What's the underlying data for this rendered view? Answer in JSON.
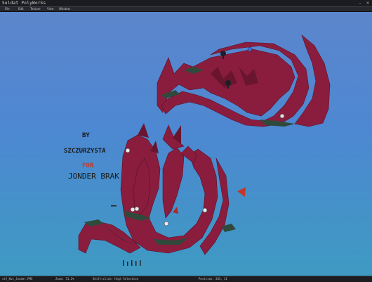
{
  "window": {
    "title": "Soldat PolyWorks",
    "minimize": "–",
    "close": "×"
  },
  "menu": {
    "items": [
      "File",
      "Edit",
      "Texture",
      "View",
      "Window"
    ]
  },
  "map": {
    "credits": {
      "line1": "BY",
      "line2": "SZCZURZYSTA",
      "line3": "FOR",
      "line4": "JONDER BRAK"
    },
    "colors": {
      "sky_top": "#5c86cc",
      "sky_bottom": "#3e9ac2",
      "polygon": "#8a1d3e",
      "polygon_dark": "#6a1530",
      "grass": "#2f4a3a",
      "flag_red": "#c0392b"
    }
  },
  "status": {
    "file": "ctf_Kut_Jonder.PMS",
    "zoom": "Zoom: 51.2%",
    "hint": "Shift+click: High Selection",
    "position": "Position: 263, 31"
  }
}
